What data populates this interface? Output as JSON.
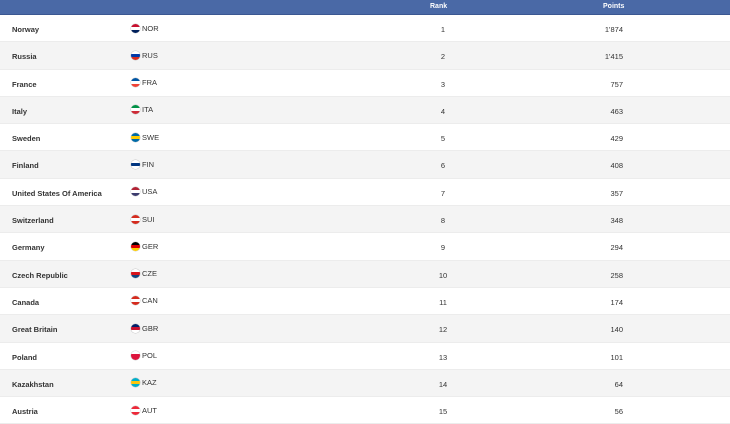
{
  "header": {
    "rank_label": "Rank",
    "points_label": "Points"
  },
  "rows": [
    {
      "country": "Norway",
      "code": "NOR",
      "rank": "1",
      "points": "1'874",
      "flag_colors": [
        "#c8102e",
        "#ffffff",
        "#00205b"
      ]
    },
    {
      "country": "Russia",
      "code": "RUS",
      "rank": "2",
      "points": "1'415",
      "flag_colors": [
        "#ffffff",
        "#0039a6",
        "#d52b1e"
      ]
    },
    {
      "country": "France",
      "code": "FRA",
      "rank": "3",
      "points": "757",
      "flag_colors": [
        "#0055a4",
        "#ffffff",
        "#ef4135"
      ]
    },
    {
      "country": "Italy",
      "code": "ITA",
      "rank": "4",
      "points": "463",
      "flag_colors": [
        "#009246",
        "#ffffff",
        "#ce2b37"
      ]
    },
    {
      "country": "Sweden",
      "code": "SWE",
      "rank": "5",
      "points": "429",
      "flag_colors": [
        "#006aa7",
        "#fecc00",
        "#006aa7"
      ]
    },
    {
      "country": "Finland",
      "code": "FIN",
      "rank": "6",
      "points": "408",
      "flag_colors": [
        "#ffffff",
        "#003580",
        "#ffffff"
      ]
    },
    {
      "country": "United States Of America",
      "code": "USA",
      "rank": "7",
      "points": "357",
      "flag_colors": [
        "#b22234",
        "#ffffff",
        "#3c3b6e"
      ]
    },
    {
      "country": "Switzerland",
      "code": "SUI",
      "rank": "8",
      "points": "348",
      "flag_colors": [
        "#d52b1e",
        "#ffffff",
        "#d52b1e"
      ]
    },
    {
      "country": "Germany",
      "code": "GER",
      "rank": "9",
      "points": "294",
      "flag_colors": [
        "#000000",
        "#dd0000",
        "#ffce00"
      ]
    },
    {
      "country": "Czech Republic",
      "code": "CZE",
      "rank": "10",
      "points": "258",
      "flag_colors": [
        "#ffffff",
        "#d7141a",
        "#11457e"
      ]
    },
    {
      "country": "Canada",
      "code": "CAN",
      "rank": "11",
      "points": "174",
      "flag_colors": [
        "#d52b1e",
        "#ffffff",
        "#d52b1e"
      ]
    },
    {
      "country": "Great Britain",
      "code": "GBR",
      "rank": "12",
      "points": "140",
      "flag_colors": [
        "#012169",
        "#c8102e",
        "#ffffff"
      ]
    },
    {
      "country": "Poland",
      "code": "POL",
      "rank": "13",
      "points": "101",
      "flag_colors": [
        "#ffffff",
        "#dc143c",
        "#dc143c"
      ]
    },
    {
      "country": "Kazakhstan",
      "code": "KAZ",
      "rank": "14",
      "points": "64",
      "flag_colors": [
        "#00afca",
        "#fec50c",
        "#00afca"
      ]
    },
    {
      "country": "Austria",
      "code": "AUT",
      "rank": "15",
      "points": "56",
      "flag_colors": [
        "#ed2939",
        "#ffffff",
        "#ed2939"
      ]
    }
  ]
}
